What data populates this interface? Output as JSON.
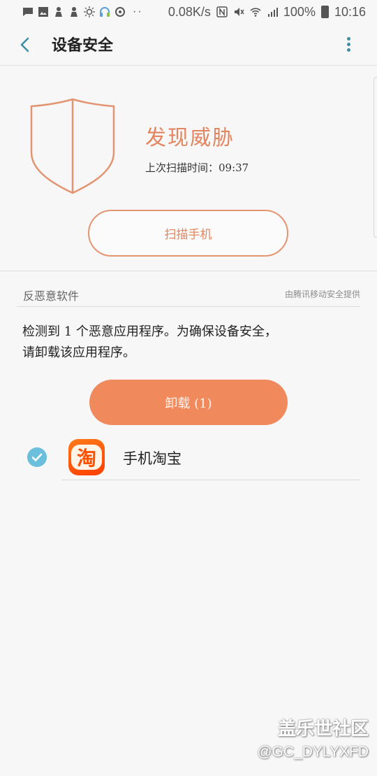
{
  "status_bar": {
    "net_speed": "0.08K/s",
    "battery": "100%",
    "time": "10:16",
    "icons": [
      "message-icon",
      "gallery-icon",
      "person-icon",
      "person-icon",
      "sun-icon",
      "headset-icon",
      "sync-icon",
      "nfc-icon",
      "mute-icon",
      "wifi-icon",
      "signal-icon",
      "battery-icon"
    ]
  },
  "app_bar": {
    "title": "设备安全"
  },
  "hero": {
    "status_title": "发现威胁",
    "last_scan": "上次扫描时间：09:37",
    "scan_button": "扫描手机",
    "accent_color": "#e3855f"
  },
  "section": {
    "title": "反恶意软件",
    "provider": "由腾讯移动安全提供",
    "description_line1": "检测到 1 个恶意应用程序。为确保设备安全，",
    "description_line2": "请卸载该应用程序。",
    "uninstall_button": "卸载 (1)",
    "button_color": "#f08a5d"
  },
  "apps": [
    {
      "name": "手机淘宝",
      "icon_glyph": "淘",
      "checked": true
    }
  ],
  "watermark": {
    "title": "盖乐世社区",
    "handle": "@GC_DYLYXFD"
  }
}
